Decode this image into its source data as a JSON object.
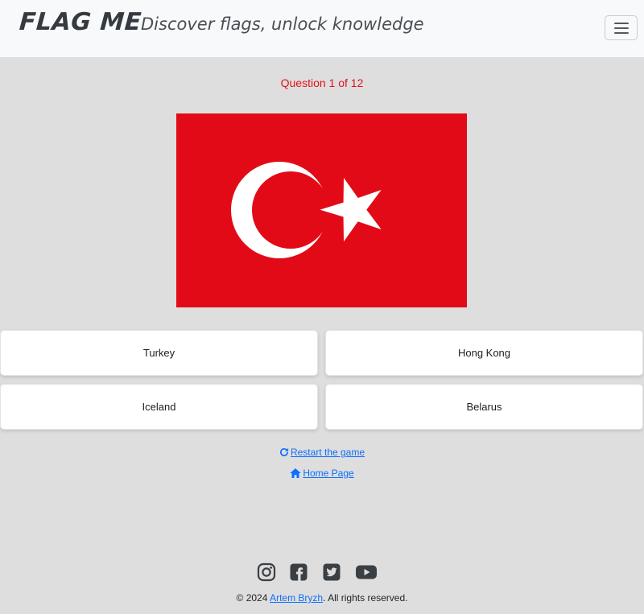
{
  "header": {
    "brand": "FLAG ME",
    "tagline": "Discover flags, unlock knowledge",
    "menu_icon": "hamburger-icon"
  },
  "quiz": {
    "counter": "Question 1 of 12",
    "flag": {
      "country": "Turkey",
      "colors": {
        "field": "#e30a17",
        "emblem": "#ffffff"
      }
    },
    "answers": [
      "Turkey",
      "Hong Kong",
      "Iceland",
      "Belarus"
    ]
  },
  "links": {
    "restart": "Restart the game",
    "restart_icon": "refresh-icon",
    "home": "Home Page",
    "home_icon": "home-icon"
  },
  "footer": {
    "socials": [
      "instagram-icon",
      "facebook-icon",
      "twitter-icon",
      "youtube-icon"
    ],
    "copyright_prefix": "© 2024 ",
    "author": "Artem Bryzh",
    "copyright_suffix": ". All rights reserved."
  },
  "colors": {
    "accent": "#0d6efd",
    "counter": "#e0121b",
    "background": "#dedede"
  }
}
